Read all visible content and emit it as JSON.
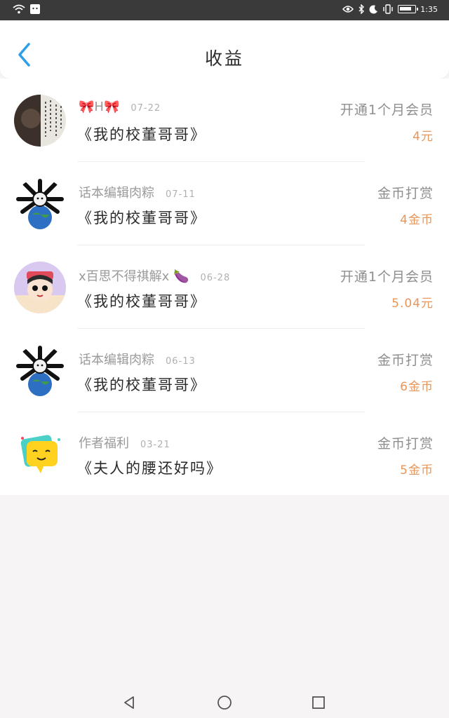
{
  "status_bar": {
    "time": "1:35"
  },
  "header": {
    "title": "收益"
  },
  "rows": [
    {
      "name": "🎀H🎀",
      "date": "07-22",
      "book": "《我的校董哥哥》",
      "type": "开通1个月会员",
      "amount": "4元"
    },
    {
      "name": "话本编辑肉粽",
      "date": "07-11",
      "book": "《我的校董哥哥》",
      "type": "金币打赏",
      "amount": "4金币"
    },
    {
      "name": "x百思不得祺解x 🍆",
      "date": "06-28",
      "book": "《我的校董哥哥》",
      "type": "开通1个月会员",
      "amount": "5.04元"
    },
    {
      "name": "话本编辑肉粽",
      "date": "06-13",
      "book": "《我的校董哥哥》",
      "type": "金币打赏",
      "amount": "6金币"
    },
    {
      "name": "作者福利",
      "date": "03-21",
      "book": "《夫人的腰还好吗》",
      "type": "金币打赏",
      "amount": "5金币"
    }
  ],
  "colors": {
    "accent": "#2d9ee8",
    "amount": "#e8965a"
  }
}
